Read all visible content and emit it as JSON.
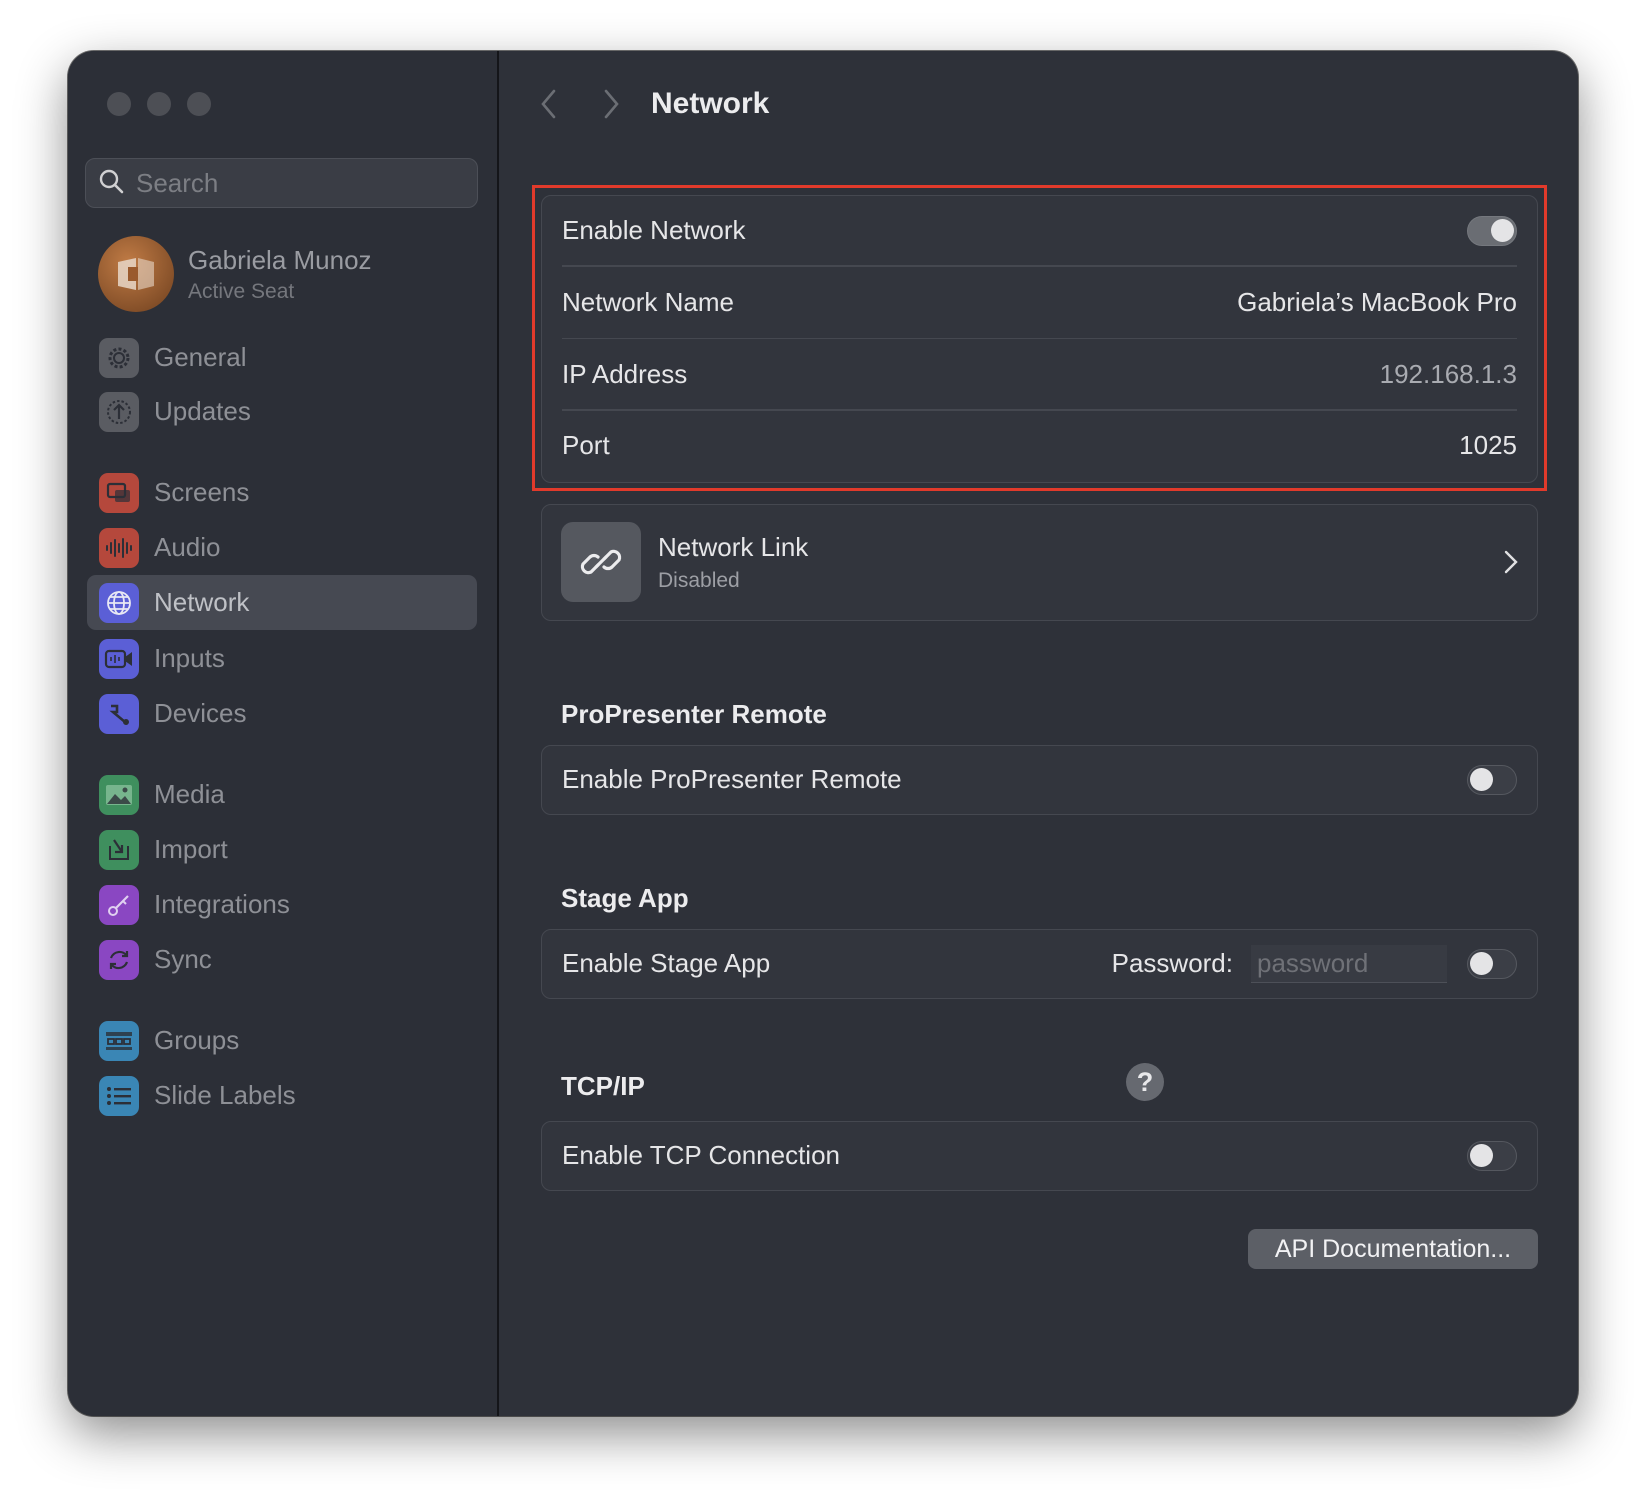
{
  "sidebar": {
    "search_placeholder": "Search",
    "account": {
      "name": "Gabriela Munoz",
      "status": "Active Seat"
    },
    "items": [
      {
        "label": "General",
        "icon": "gear-icon",
        "color": "#5a5c62"
      },
      {
        "label": "Updates",
        "icon": "upload-icon",
        "color": "#5a5c62"
      },
      {
        "label": "Screens",
        "icon": "screens-icon",
        "color": "#b5483c"
      },
      {
        "label": "Audio",
        "icon": "audio-waveform-icon",
        "color": "#b5483c"
      },
      {
        "label": "Network",
        "icon": "globe-icon",
        "color": "#5b5fd6",
        "selected": true
      },
      {
        "label": "Inputs",
        "icon": "video-input-icon",
        "color": "#5b5fd6"
      },
      {
        "label": "Devices",
        "icon": "devices-icon",
        "color": "#5b5fd6"
      },
      {
        "label": "Media",
        "icon": "image-icon",
        "color": "#3f8f5e"
      },
      {
        "label": "Import",
        "icon": "import-icon",
        "color": "#3f8f5e"
      },
      {
        "label": "Integrations",
        "icon": "integrations-icon",
        "color": "#8a47c2"
      },
      {
        "label": "Sync",
        "icon": "sync-icon",
        "color": "#8a47c2"
      },
      {
        "label": "Groups",
        "icon": "groups-icon",
        "color": "#3a86b5"
      },
      {
        "label": "Slide Labels",
        "icon": "list-icon",
        "color": "#3a86b5"
      }
    ]
  },
  "header": {
    "title": "Network"
  },
  "network": {
    "enable_label": "Enable Network",
    "enabled": true,
    "name_label": "Network Name",
    "name_value": "Gabriela’s MacBook Pro",
    "ip_label": "IP Address",
    "ip_value": "192.168.1.3",
    "port_label": "Port",
    "port_value": "1025"
  },
  "network_link": {
    "title": "Network Link",
    "status": "Disabled"
  },
  "remote": {
    "section_title": "ProPresenter Remote",
    "enable_label": "Enable ProPresenter Remote",
    "enabled": false
  },
  "stage": {
    "section_title": "Stage App",
    "enable_label": "Enable Stage App",
    "password_label": "Password:",
    "password_placeholder": "password",
    "enabled": false
  },
  "tcp": {
    "section_title": "TCP/IP",
    "help": "?",
    "enable_label": "Enable TCP Connection",
    "enabled": false,
    "api_button": "API Documentation..."
  },
  "colors": {
    "highlight": "#e13a2b",
    "window_bg": "#2e3139"
  }
}
